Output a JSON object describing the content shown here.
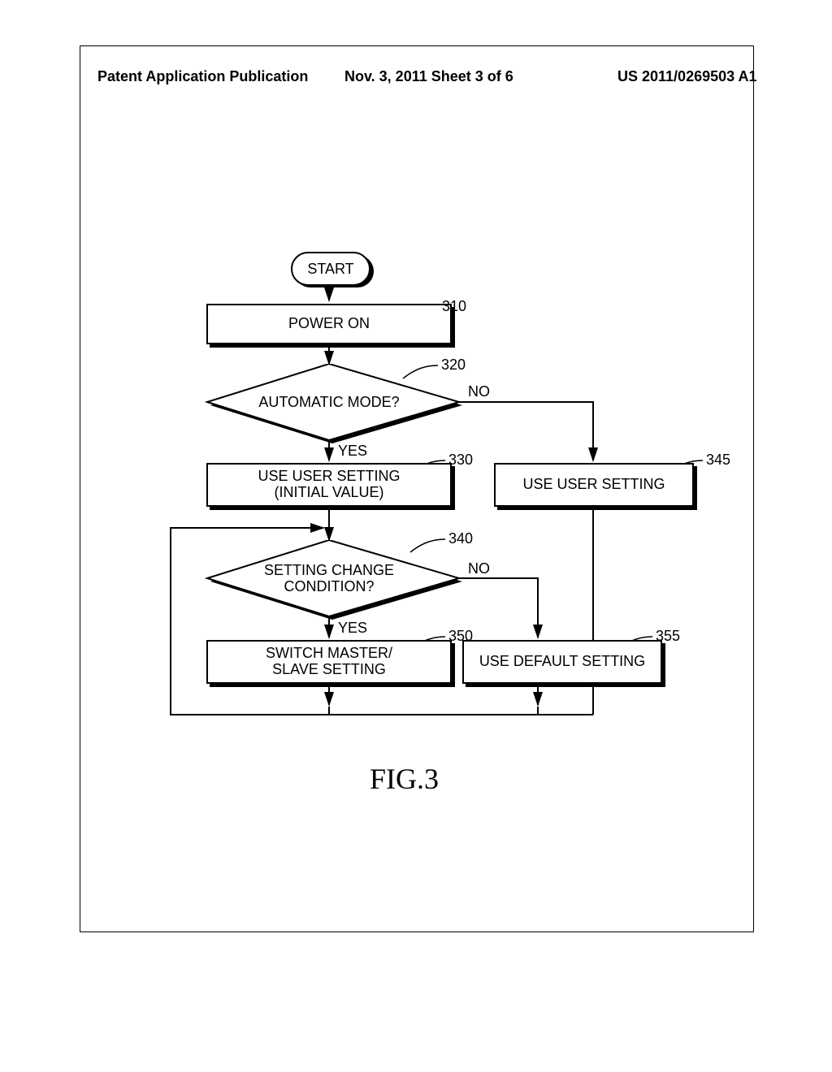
{
  "header": {
    "left": "Patent Application Publication",
    "mid": "Nov. 3, 2011  Sheet 3 of 6",
    "right": "US 2011/0269503 A1"
  },
  "figure_label": "FIG.3",
  "nodes": {
    "start": "START",
    "power_on": "POWER ON",
    "auto_mode": "AUTOMATIC MODE?",
    "use_user_initial_l1": "USE USER SETTING",
    "use_user_initial_l2": "(INITIAL VALUE)",
    "use_user_setting": "USE USER SETTING",
    "setting_change_l1": "SETTING CHANGE",
    "setting_change_l2": "CONDITION?",
    "switch_l1": "SWITCH MASTER/",
    "switch_l2": "SLAVE SETTING",
    "use_default": "USE DEFAULT SETTING"
  },
  "labels": {
    "yes": "YES",
    "no": "NO"
  },
  "refs": {
    "r310": "310",
    "r320": "320",
    "r330": "330",
    "r340": "340",
    "r345": "345",
    "r350": "350",
    "r355": "355"
  }
}
